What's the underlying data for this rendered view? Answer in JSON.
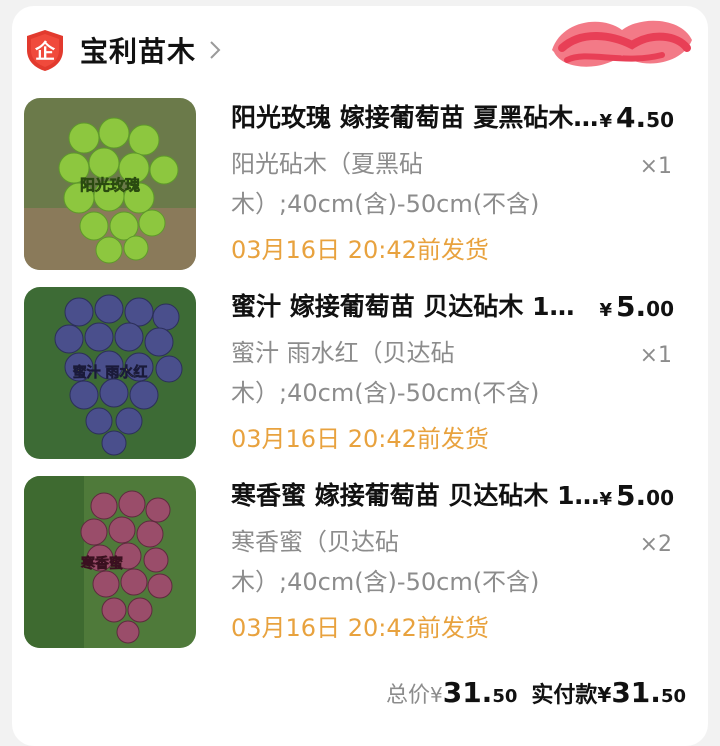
{
  "shop": {
    "name": "宝利苗木",
    "logo_char": "企"
  },
  "items": [
    {
      "title": "阳光玫瑰  嫁接葡萄苗 夏黑砧木 1…",
      "price_currency": "¥",
      "price_int": "4.",
      "price_dec": "50",
      "sku_line1": "阳光砧木（夏黑砧",
      "sku_line2": "木）;40cm(含)-50cm(不含)",
      "qty": "×1",
      "ship": "03月16日 20:42前发货",
      "image_label": "阳光玫瑰",
      "image_color": "#8dc73f"
    },
    {
      "title": "蜜汁  嫁接葡萄苗 贝达砧木  1…",
      "price_currency": "¥",
      "price_int": "5.",
      "price_dec": "00",
      "sku_line1": "蜜汁 雨水红（贝达砧",
      "sku_line2": "木）;40cm(含)-50cm(不含)",
      "qty": "×1",
      "ship": "03月16日 20:42前发货",
      "image_label": "蜜汁 雨水红",
      "image_color": "#4a4f8c"
    },
    {
      "title": "寒香蜜  嫁接葡萄苗 贝达砧木 1…",
      "price_currency": "¥",
      "price_int": "5.",
      "price_dec": "00",
      "sku_line1": "寒香蜜（贝达砧",
      "sku_line2": "木）;40cm(含)-50cm(不含)",
      "qty": "×2",
      "ship": "03月16日 20:42前发货",
      "image_label": "寒香蜜",
      "image_color": "#9a4d6a"
    }
  ],
  "totals": {
    "total_label": "总价",
    "total_currency": "¥",
    "total_int": "31.",
    "total_dec": "50",
    "paid_label": "实付款",
    "paid_currency": "¥",
    "paid_int": "31.",
    "paid_dec": "50"
  },
  "colors": {
    "ship_text": "#e8a23e",
    "logo_red": "#e23a2e"
  }
}
